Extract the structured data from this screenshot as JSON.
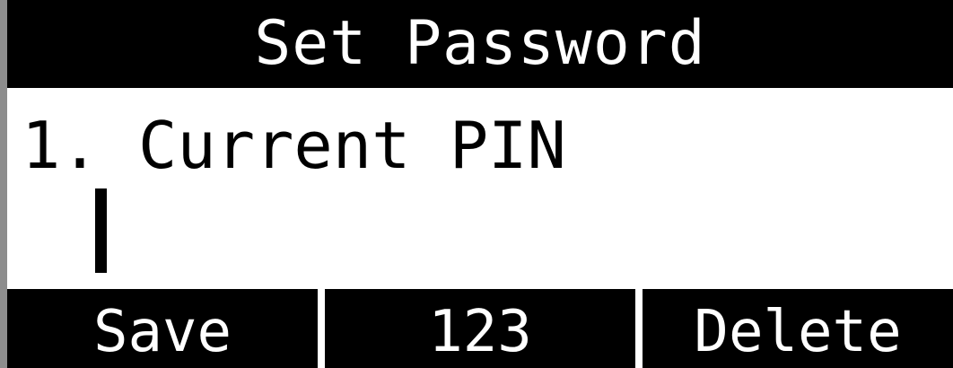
{
  "screen": {
    "title": "Set Password",
    "field": {
      "label": "1. Current PIN",
      "value": ""
    },
    "softkeys": [
      {
        "label": "Save"
      },
      {
        "label": "123"
      },
      {
        "label": "Delete"
      }
    ]
  },
  "colors": {
    "background": "#ffffff",
    "bar": "#000000",
    "bar_text": "#ffffff",
    "left_edge": "#8d8d8d"
  }
}
